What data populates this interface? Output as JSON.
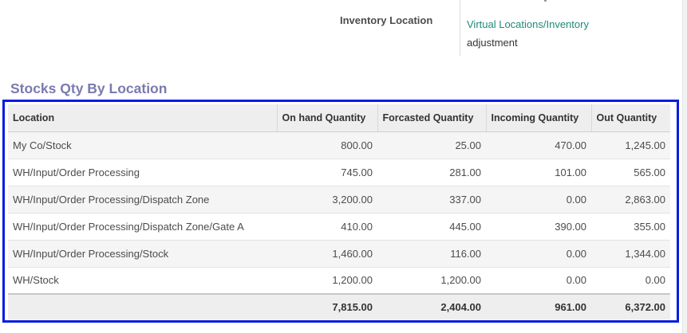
{
  "inventory_field": {
    "label": "Inventory Location",
    "value_link": "Virtual Locations/Inventory",
    "value_rest": "adjustment"
  },
  "section": {
    "title": "Stocks Qty By Location"
  },
  "table": {
    "headers": [
      "Location",
      "On hand Quantity",
      "Forcasted Quantity",
      "Incoming Quantity",
      "Out Quantity"
    ],
    "rows": [
      [
        "My Co/Stock",
        "800.00",
        "25.00",
        "470.00",
        "1,245.00"
      ],
      [
        "WH/Input/Order Processing",
        "745.00",
        "281.00",
        "101.00",
        "565.00"
      ],
      [
        "WH/Input/Order Processing/Dispatch Zone",
        "3,200.00",
        "337.00",
        "0.00",
        "2,863.00"
      ],
      [
        "WH/Input/Order Processing/Dispatch Zone/Gate A",
        "410.00",
        "445.00",
        "390.00",
        "355.00"
      ],
      [
        "WH/Input/Order Processing/Stock",
        "1,460.00",
        "116.00",
        "0.00",
        "1,344.00"
      ],
      [
        "WH/Stock",
        "1,200.00",
        "1,200.00",
        "0.00",
        "0.00"
      ]
    ],
    "totals": [
      "",
      "7,815.00",
      "2,404.00",
      "961.00",
      "6,372.00"
    ]
  },
  "colors": {
    "section_title": "#7a7ab0",
    "link": "#1d8a7a",
    "highlight_border": "#0b1be0"
  }
}
